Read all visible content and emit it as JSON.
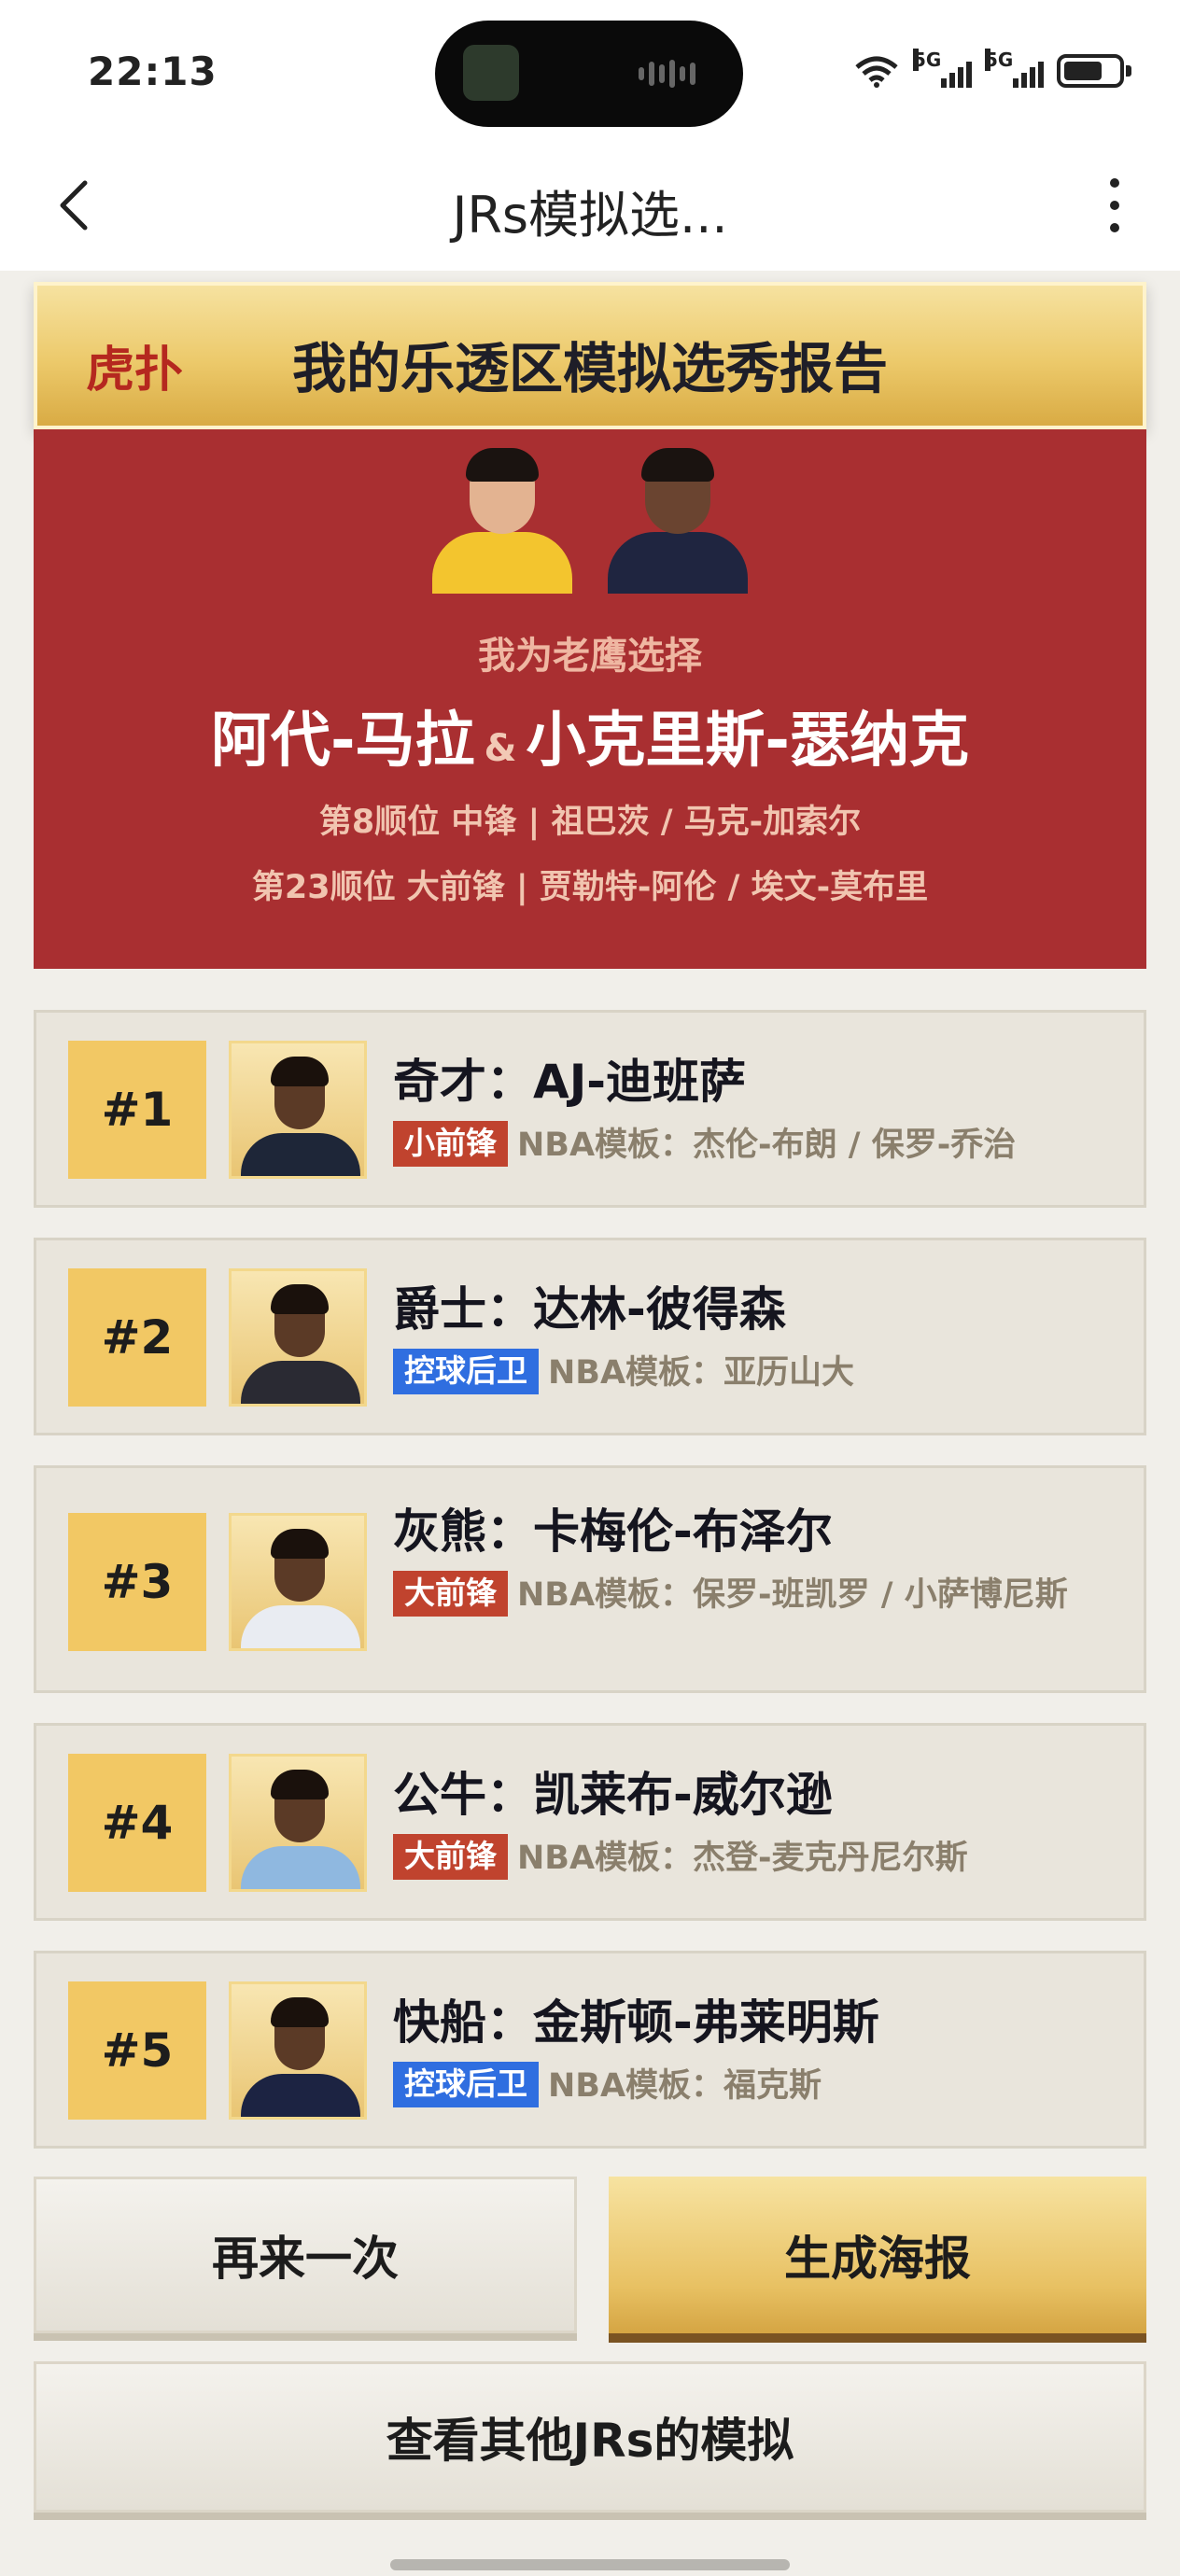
{
  "status_bar": {
    "time": "22:13",
    "signal1": "5G",
    "signal2": "5G"
  },
  "nav": {
    "title": "JRs模拟选..."
  },
  "banner": {
    "logo": "虎扑",
    "title": "我的乐透区模拟选秀报告"
  },
  "my_pick": {
    "subtitle": "我为老鹰选择",
    "player1": "阿代-马拉",
    "amp": "&",
    "player2": "小克里斯-瑟纳克",
    "line1": "第8顺位 中锋 | 祖巴茨 / 马克-加索尔",
    "line2": "第23顺位 大前锋 | 贾勒特-阿伦 / 埃文-莫布里"
  },
  "picks": [
    {
      "rank": "#1",
      "name": "奇才：AJ-迪班萨",
      "position": "小前锋",
      "position_color": "red",
      "template": "NBA模板：杰伦-布朗 / 保罗-乔治"
    },
    {
      "rank": "#2",
      "name": "爵士：达林-彼得森",
      "position": "控球后卫",
      "position_color": "blue",
      "template": "NBA模板：亚历山大"
    },
    {
      "rank": "#3",
      "name": "灰熊：卡梅伦-布泽尔",
      "position": "大前锋",
      "position_color": "red",
      "template": "NBA模板：保罗-班凯罗 / 小萨博尼斯"
    },
    {
      "rank": "#4",
      "name": "公牛：凯莱布-威尔逊",
      "position": "大前锋",
      "position_color": "red",
      "template": "NBA模板：杰登-麦克丹尼尔斯"
    },
    {
      "rank": "#5",
      "name": "快船：金斯顿-弗莱明斯",
      "position": "控球后卫",
      "position_color": "blue",
      "template": "NBA模板：福克斯"
    }
  ],
  "buttons": {
    "retry": "再来一次",
    "poster": "生成海报",
    "others": "查看其他JRs的模拟"
  },
  "colors": {
    "accent_gold": "#f2c864",
    "card_red": "#a92f31",
    "tag_red": "#c0432e",
    "tag_blue": "#2f6ee0"
  }
}
